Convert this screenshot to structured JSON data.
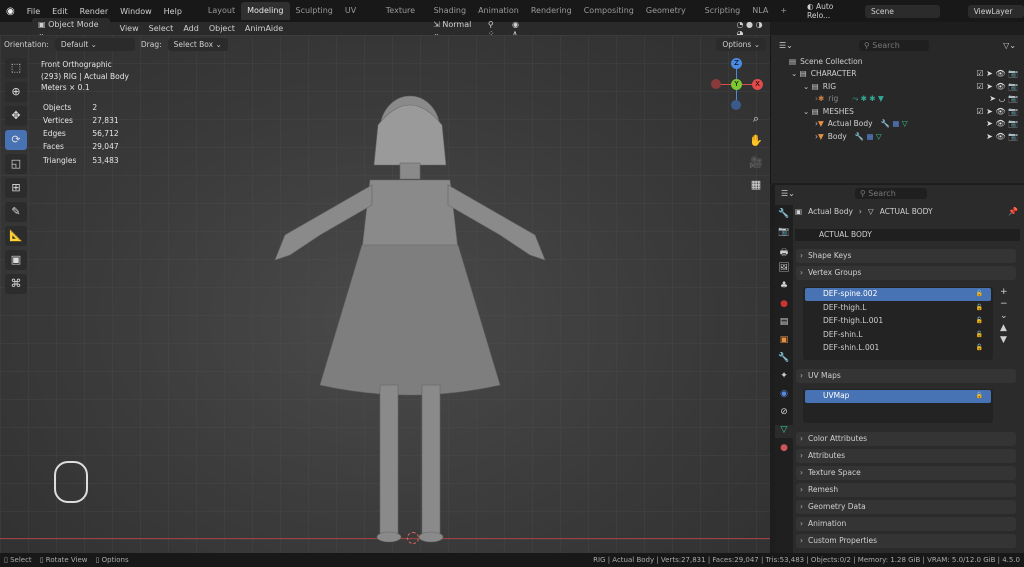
{
  "topbar": {
    "menu": [
      "File",
      "Edit",
      "Render",
      "Window",
      "Help"
    ],
    "workspaces": [
      "Layout",
      "Modeling",
      "Sculpting",
      "UV Editing",
      "Texture Paint",
      "Shading",
      "Animation",
      "Rendering",
      "Compositing",
      "Geometry Nodes",
      "Scripting",
      "NLA",
      "+"
    ],
    "active_workspace": "Modeling",
    "auto_reload": "Auto Relo...",
    "scene": "Scene",
    "view_layer": "ViewLayer"
  },
  "header": {
    "mode": "Object Mode",
    "menus": [
      "View",
      "Select",
      "Add",
      "Object",
      "AnimAide"
    ],
    "transform_orientation": "Normal",
    "options": "Options"
  },
  "orient": {
    "orientation_label": "Orientation:",
    "orientation": "Default",
    "drag_label": "Drag:",
    "drag": "Select Box"
  },
  "overlay": {
    "view": "Front Orthographic",
    "context": "(293) RIG | Actual Body",
    "units": "Meters × 0.1",
    "stats": [
      {
        "k": "Objects",
        "v": "2"
      },
      {
        "k": "Vertices",
        "v": "27,831"
      },
      {
        "k": "Edges",
        "v": "56,712"
      },
      {
        "k": "Faces",
        "v": "29,047"
      },
      {
        "k": "Triangles",
        "v": "53,483"
      }
    ]
  },
  "gizmo": {
    "x": "X",
    "y": "Y",
    "z": "Z"
  },
  "outliner": {
    "search_placeholder": "Search",
    "items": [
      {
        "label": "Scene Collection"
      },
      {
        "label": "CHARACTER"
      },
      {
        "label": "RIG"
      },
      {
        "label": "rig"
      },
      {
        "label": "MESHES"
      },
      {
        "label": "Actual Body"
      },
      {
        "label": "Body"
      }
    ]
  },
  "properties": {
    "search_placeholder": "Search",
    "breadcrumb_object": "Actual Body",
    "breadcrumb_data": "ACTUAL BODY",
    "mesh_name": "ACTUAL BODY",
    "panels": {
      "shape_keys": "Shape Keys",
      "vertex_groups": "Vertex Groups",
      "uv_maps": "UV Maps",
      "color_attributes": "Color Attributes",
      "attributes": "Attributes",
      "texture_space": "Texture Space",
      "remesh": "Remesh",
      "geometry_data": "Geometry Data",
      "animation": "Animation",
      "custom_properties": "Custom Properties"
    },
    "vertex_groups": [
      "DEF-spine.002",
      "DEF-thigh.L",
      "DEF-thigh.L.001",
      "DEF-shin.L",
      "DEF-shin.L.001"
    ],
    "uv_maps": [
      "UVMap"
    ]
  },
  "status": {
    "left": [
      "Select",
      "Rotate View",
      "Options"
    ],
    "right": "RIG | Actual Body | Verts:27,831 | Faces:29,047 | Tris:53,483 | Objects:0/2 | Memory: 1.28 GiB | VRAM: 5.0/12.0 GiB | 4.5.0"
  },
  "colors": {
    "accent": "#4772b3",
    "x_axis": "#e14b4b",
    "y_axis": "#7cc832",
    "z_axis": "#4a8ae0"
  }
}
